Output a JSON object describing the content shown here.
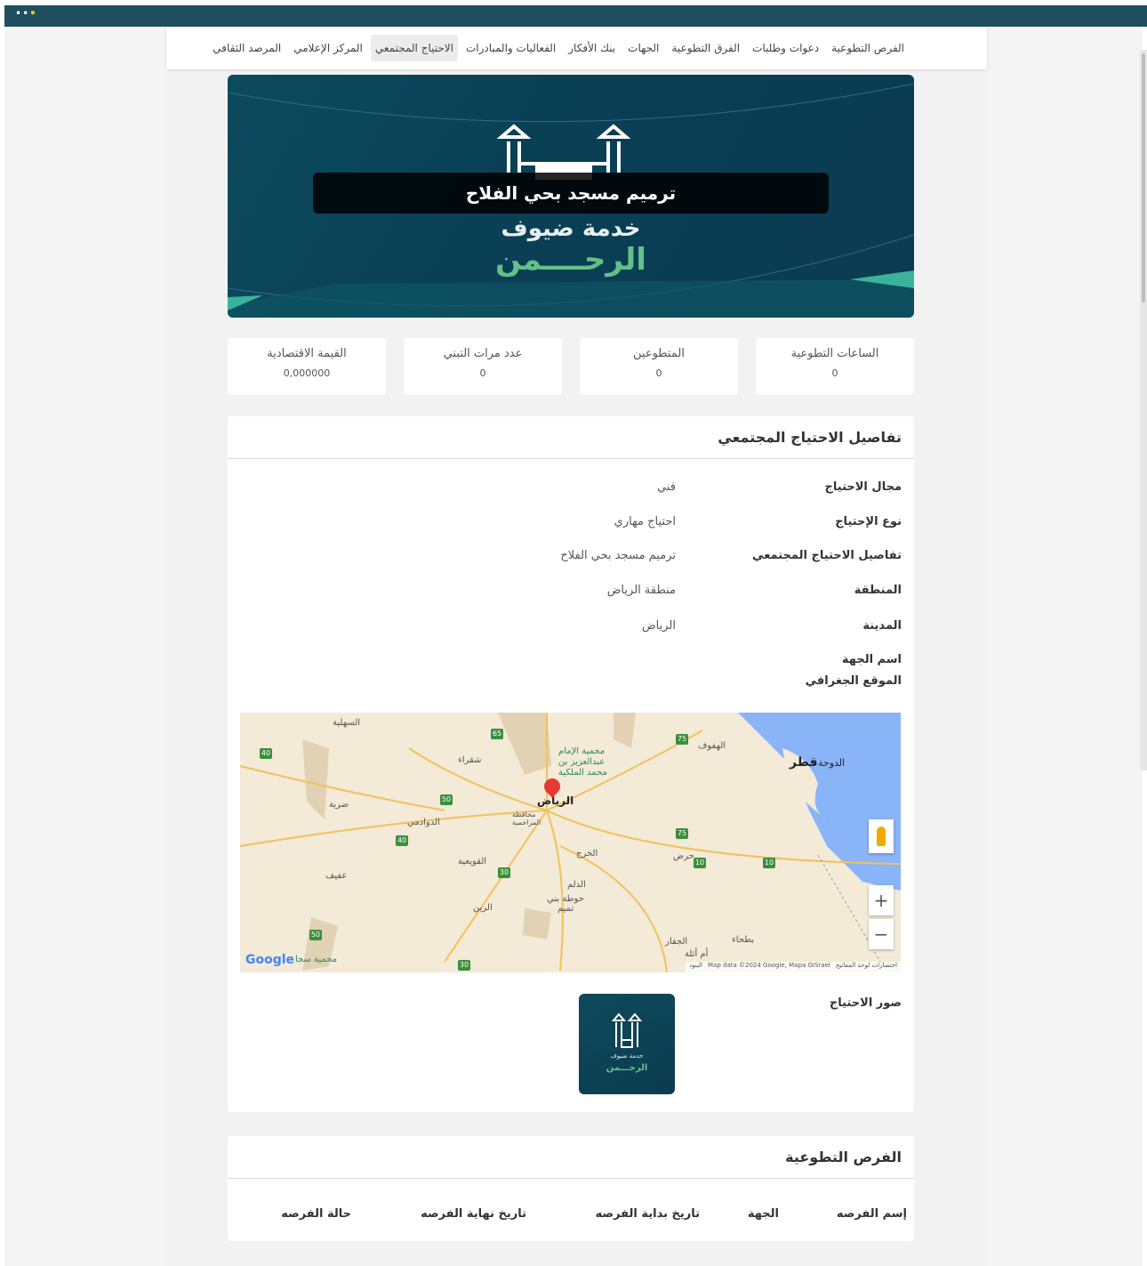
{
  "nav": {
    "items": [
      "الفرص التطوعية",
      "دعوات وطلبات",
      "الفرق التطوعية",
      "الجهات",
      "بنك الأفكار",
      "الفعاليات والمبادرات",
      "الاحتياج المجتمعي",
      "المركز الإعلامي",
      "المرصد الثقافي"
    ],
    "active_index": 6
  },
  "banner": {
    "title": "ترميم مسجد بحي الفلاح",
    "brand_line1": "خدمة ضيوف",
    "brand_line2": "الرحــــمن"
  },
  "stats": [
    {
      "label": "الساعات التطوعية",
      "value": "0"
    },
    {
      "label": "المتطوعين",
      "value": "0"
    },
    {
      "label": "عدد مرات التبني",
      "value": "0"
    },
    {
      "label": "القيمة الاقتصادية",
      "value": "0,000000"
    }
  ],
  "details": {
    "heading": "تفاصيل الاحتياج المجتمعي",
    "rows": [
      {
        "key": "مجال الاحتياج",
        "value": "فني"
      },
      {
        "key": "نوع الإحتياج",
        "value": "احتياج مهاري"
      },
      {
        "key": "تفاصيل الاحتياج المجتمعي",
        "value": "ترميم مسجد بحي الفلاح"
      },
      {
        "key": "المنطقة",
        "value": "منطقة الرياض"
      },
      {
        "key": "المدينة",
        "value": "الرياض"
      },
      {
        "key": "اسم الجهة",
        "value": ""
      },
      {
        "key": "الموقع الجغرافي",
        "value": ""
      }
    ],
    "images_label": "صور الاحتياج"
  },
  "map": {
    "labels": {
      "riyadh": "الرياض",
      "qatar": "قطر",
      "doha": "الدوحة",
      "hufuf": "الهفوف",
      "shaqra": "شقراء",
      "dawadmi": "الدوادمي",
      "quwaiyah": "القويعية",
      "kharj": "الخرج",
      "harad": "حرض",
      "dilam": "الدلم",
      "hawtat": "حوطة بني تميم",
      "afif": "عفيف",
      "sulayyil": "السهلية",
      "reserve": "محمية الإمام عبدالعزيز بن محمد الملكية",
      "muzahmiya": "محافظة المزاحمية",
      "quwayiyah2": "ضرية",
      "rayn": "الرين",
      "jafurah": "الجفار",
      "ulaybah": "أم أثلة",
      "batha": "بطحاء",
      "sajir": "محمية سجا",
      "google": "Google",
      "attribution": "Map data ©2024 Google, Mapa GISrael",
      "shortcuts": "اختصارات لوحة المفاتيح",
      "terms": "البنود"
    },
    "zoom_in": "+",
    "zoom_out": "−"
  },
  "thumbnail": {
    "line1": "خدمة ضيوف",
    "line2": "الرحـــمن"
  },
  "opportunities": {
    "heading": "الفرص التطوعية",
    "columns": [
      "إسم الفرصه",
      "الجهة",
      "تاريخ بداية الفرصه",
      "تاريخ نهاية الفرصه",
      "حالة الفرصه"
    ]
  },
  "colors": {
    "topbar": "#1f4e5f",
    "banner": "#0b3f54",
    "brand_green": "#63c08a"
  }
}
